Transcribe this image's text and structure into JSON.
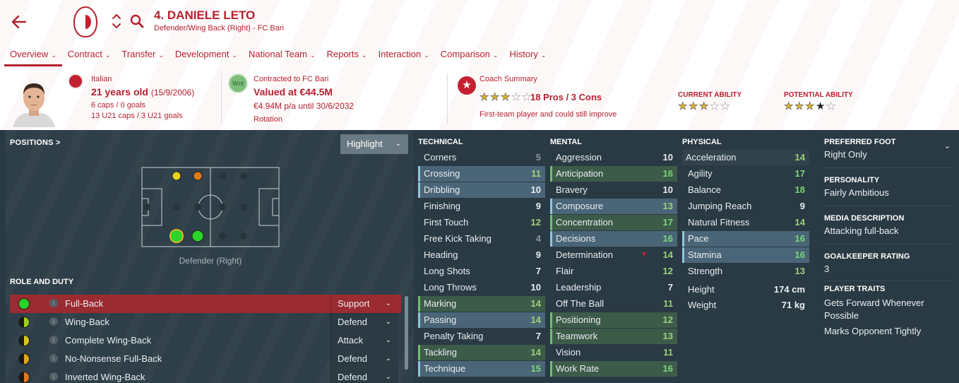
{
  "header": {
    "player_title": "4. DANIELE LETO",
    "player_subtitle": "Defender/Wing Back (Right) - FC Bari",
    "nationality": "Italian",
    "age": "21 years old",
    "dob": "(15/9/2006)",
    "caps": "6 caps / 0 goals",
    "u21_caps": "13 U21 caps / 3 U21 goals",
    "contract_label": "Contracted to FC Bari",
    "value": "Valued at €44.5M",
    "wage": "€4.94M p/a until 30/6/2032",
    "squad_status": "Rotation",
    "wnt_badge": "Wnt",
    "coach_summary_label": "Coach Summary",
    "coach_pros_cons": "18 Pros / 3 Cons",
    "coach_comment": "First-team player and could still improve",
    "current_ability_label": "CURRENT ABILITY",
    "potential_ability_label": "POTENTIAL ABILITY",
    "coach_stars": 3,
    "current_ability_stars": 3,
    "potential_ability_stars": 3.5,
    "accent_color": "#b61f2e"
  },
  "tabs": [
    {
      "label": "Overview",
      "active": true
    },
    {
      "label": "Contract"
    },
    {
      "label": "Transfer"
    },
    {
      "label": "Development"
    },
    {
      "label": "National Team"
    },
    {
      "label": "Reports"
    },
    {
      "label": "Interaction"
    },
    {
      "label": "Comparison"
    },
    {
      "label": "History"
    }
  ],
  "positions": {
    "heading": "POSITIONS >",
    "highlight_label": "Highlight",
    "position_label": "Defender (Right)"
  },
  "roles": {
    "heading": "ROLE AND DUTY",
    "info_glyph": "i",
    "items": [
      {
        "name": "Full-Back",
        "duty": "Support",
        "dot_color": "#27d627",
        "selected": true
      },
      {
        "name": "Wing-Back",
        "duty": "Defend",
        "dot_color": "#9bd01c"
      },
      {
        "name": "Complete Wing-Back",
        "duty": "Attack",
        "dot_color": "#d6c81c"
      },
      {
        "name": "No-Nonsense Full-Back",
        "duty": "Defend",
        "dot_color": "#e0a51c"
      },
      {
        "name": "Inverted Wing-Back",
        "duty": "Defend",
        "dot_color": "#e07a1c"
      }
    ]
  },
  "technical": {
    "heading": "TECHNICAL",
    "attrs": [
      {
        "name": "Corners",
        "value": "5"
      },
      {
        "name": "Crossing",
        "value": "11",
        "style": "hl"
      },
      {
        "name": "Dribbling",
        "value": "10",
        "style": "hl"
      },
      {
        "name": "Finishing",
        "value": "9"
      },
      {
        "name": "First Touch",
        "value": "12"
      },
      {
        "name": "Free Kick Taking",
        "value": "4"
      },
      {
        "name": "Heading",
        "value": "9"
      },
      {
        "name": "Long Shots",
        "value": "7"
      },
      {
        "name": "Long Throws",
        "value": "10"
      },
      {
        "name": "Marking",
        "value": "14",
        "style": "key"
      },
      {
        "name": "Passing",
        "value": "14",
        "style": "hl"
      },
      {
        "name": "Penalty Taking",
        "value": "7"
      },
      {
        "name": "Tackling",
        "value": "14",
        "style": "key"
      },
      {
        "name": "Technique",
        "value": "15",
        "style": "hl"
      }
    ]
  },
  "mental": {
    "heading": "MENTAL",
    "attrs": [
      {
        "name": "Aggression",
        "value": "10"
      },
      {
        "name": "Anticipation",
        "value": "16",
        "style": "key"
      },
      {
        "name": "Bravery",
        "value": "10"
      },
      {
        "name": "Composure",
        "value": "13",
        "style": "hl"
      },
      {
        "name": "Concentration",
        "value": "17",
        "style": "key"
      },
      {
        "name": "Decisions",
        "value": "16",
        "style": "hl"
      },
      {
        "name": "Determination",
        "value": "14",
        "trend": "down"
      },
      {
        "name": "Flair",
        "value": "12"
      },
      {
        "name": "Leadership",
        "value": "7"
      },
      {
        "name": "Off The Ball",
        "value": "11"
      },
      {
        "name": "Positioning",
        "value": "12",
        "style": "key"
      },
      {
        "name": "Teamwork",
        "value": "13",
        "style": "key"
      },
      {
        "name": "Vision",
        "value": "11"
      },
      {
        "name": "Work Rate",
        "value": "16",
        "style": "key"
      }
    ]
  },
  "physical": {
    "heading": "PHYSICAL",
    "attrs": [
      {
        "name": "Acceleration",
        "value": "14",
        "style": "nk"
      },
      {
        "name": "Agility",
        "value": "17"
      },
      {
        "name": "Balance",
        "value": "18"
      },
      {
        "name": "Jumping Reach",
        "value": "9"
      },
      {
        "name": "Natural Fitness",
        "value": "14"
      },
      {
        "name": "Pace",
        "value": "16",
        "style": "hl"
      },
      {
        "name": "Stamina",
        "value": "16",
        "style": "hl"
      },
      {
        "name": "Strength",
        "value": "13"
      }
    ],
    "height_label": "Height",
    "height_value": "174 cm",
    "weight_label": "Weight",
    "weight_value": "71 kg"
  },
  "details": {
    "preferred_foot_label": "PREFERRED FOOT",
    "preferred_foot": "Right Only",
    "personality_label": "PERSONALITY",
    "personality": "Fairly Ambitious",
    "media_label": "MEDIA DESCRIPTION",
    "media": "Attacking full-back",
    "gk_rating_label": "GOALKEEPER RATING",
    "gk_rating": "3",
    "traits_label": "PLAYER TRAITS",
    "traits": [
      "Gets Forward Whenever Possible",
      "Marks Opponent Tightly"
    ]
  }
}
